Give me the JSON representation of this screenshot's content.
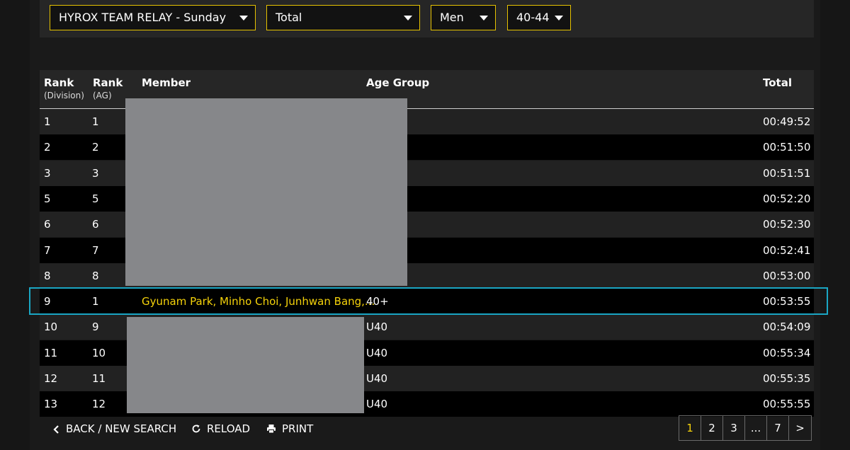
{
  "filters": {
    "event": "HYROX TEAM RELAY - Sunday",
    "split": "Total",
    "gender": "Men",
    "age_group": "40-44"
  },
  "table": {
    "headers": {
      "rank_division": "Rank",
      "rank_division_sub": "(Division)",
      "rank_ag": "Rank",
      "rank_ag_sub": "(AG)",
      "member": "Member",
      "age_group": "Age Group",
      "total": "Total"
    },
    "rows": [
      {
        "rank_div": "1",
        "rank_ag": "1",
        "member": "",
        "age_group": "",
        "total": "00:49:52"
      },
      {
        "rank_div": "2",
        "rank_ag": "2",
        "member": "",
        "age_group": "",
        "total": "00:51:50"
      },
      {
        "rank_div": "3",
        "rank_ag": "3",
        "member": "",
        "age_group": "",
        "total": "00:51:51"
      },
      {
        "rank_div": "5",
        "rank_ag": "5",
        "member": "",
        "age_group": "",
        "total": "00:52:20"
      },
      {
        "rank_div": "6",
        "rank_ag": "6",
        "member": "",
        "age_group": "",
        "total": "00:52:30"
      },
      {
        "rank_div": "7",
        "rank_ag": "7",
        "member": "",
        "age_group": "",
        "total": "00:52:41"
      },
      {
        "rank_div": "8",
        "rank_ag": "8",
        "member": "",
        "age_group": "",
        "total": "00:53:00"
      },
      {
        "rank_div": "9",
        "rank_ag": "1",
        "member": "Gyunam Park, Minho Choi, Junhwan Bang,...",
        "age_group": "40+",
        "total": "00:53:55"
      },
      {
        "rank_div": "10",
        "rank_ag": "9",
        "member": "",
        "age_group": "U40",
        "total": "00:54:09"
      },
      {
        "rank_div": "11",
        "rank_ag": "10",
        "member": "",
        "age_group": "U40",
        "total": "00:55:34"
      },
      {
        "rank_div": "12",
        "rank_ag": "11",
        "member": "",
        "age_group": "U40",
        "total": "00:55:35"
      },
      {
        "rank_div": "13",
        "rank_ag": "12",
        "member": "",
        "age_group": "U40",
        "total": "00:55:55"
      }
    ]
  },
  "footer": {
    "back_label": "BACK / NEW SEARCH",
    "reload_label": "RELOAD",
    "print_label": "PRINT"
  },
  "pagination": {
    "pages": [
      "1",
      "2",
      "3",
      "...",
      "7",
      ">"
    ],
    "active": "1"
  },
  "colors": {
    "accent": "#f5d20a",
    "highlight_border": "#1aa6c4",
    "redaction": "#86878a"
  },
  "icons": {
    "back": "chevron-left-icon",
    "reload": "reload-icon",
    "print": "printer-icon",
    "dropdown": "caret-down-icon"
  }
}
